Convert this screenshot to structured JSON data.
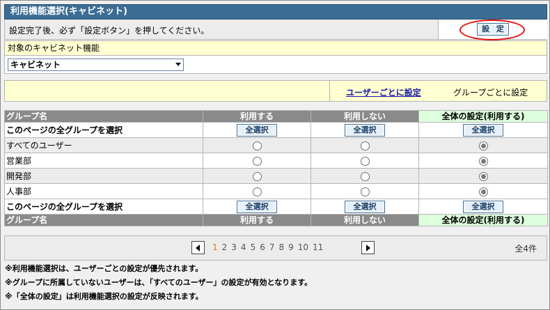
{
  "title": "利用機能選択(キャビネット)",
  "notice": "設定完了後、必ず「設定ボタン」を押してください。",
  "settle_button": "設 定",
  "target": {
    "label": "対象のキャビネット機能",
    "selected": "キャビネット"
  },
  "mode": {
    "by_user_link": "ユーザーごとに設定",
    "by_group_current": "グループごとに設定"
  },
  "table": {
    "headers": [
      "グループ名",
      "利用する",
      "利用しない",
      "全体の設定(利用する)"
    ],
    "select_all_label": "このページの全グループを選択",
    "select_all_button": "全選択",
    "rows": [
      {
        "name": "すべてのユーザー",
        "selected": "all"
      },
      {
        "name": "営業部",
        "selected": "all"
      },
      {
        "name": "開発部",
        "selected": "all"
      },
      {
        "name": "人事部",
        "selected": "all"
      }
    ]
  },
  "pager": {
    "pages": [
      "1",
      "2",
      "3",
      "4",
      "5",
      "6",
      "7",
      "8",
      "9",
      "10",
      "11"
    ],
    "current": "1",
    "total": "全4件"
  },
  "notes": [
    "※利用機能選択は、ユーザーごとの設定が優先されます。",
    "※グループに所属していないユーザーは、「すべてのユーザー」の設定が有効となります。",
    "※「全体の設定」は利用機能選択の設定が反映されます。"
  ],
  "colors": {
    "titlebar": "#3b6d95",
    "yellow": "#ffffd2",
    "header_grey": "#8a8a8a",
    "header_green": "#dcffdc",
    "highlight_ellipse": "#e20f0f",
    "current_page": "#e07a00"
  }
}
